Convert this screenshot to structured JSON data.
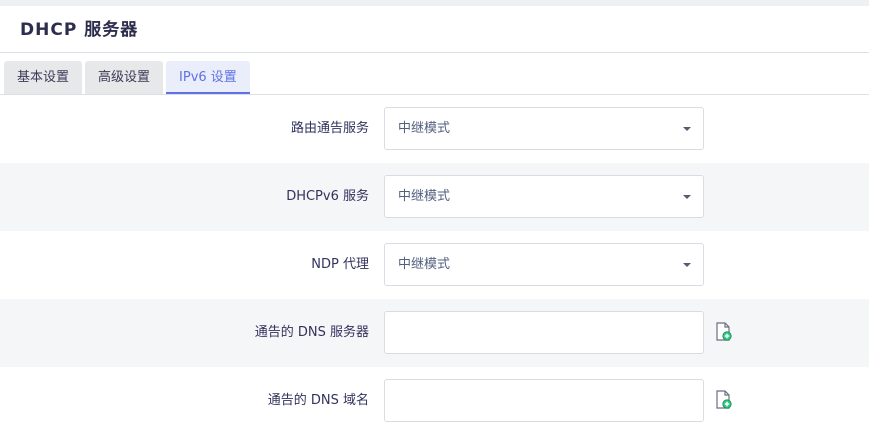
{
  "section": {
    "title": "DHCP 服务器"
  },
  "tabs": [
    {
      "label": "基本设置",
      "active": false
    },
    {
      "label": "高级设置",
      "active": false
    },
    {
      "label": "IPv6 设置",
      "active": true
    }
  ],
  "form": {
    "router_advert": {
      "label": "路由通告服务",
      "value": "中继模式"
    },
    "dhcpv6": {
      "label": "DHCPv6 服务",
      "value": "中继模式"
    },
    "ndp_proxy": {
      "label": "NDP 代理",
      "value": "中继模式"
    },
    "dns_servers": {
      "label": "通告的 DNS 服务器",
      "value": "",
      "add_icon": "add-entry-icon"
    },
    "dns_domains": {
      "label": "通告的 DNS 域名",
      "value": "",
      "add_icon": "add-entry-icon"
    }
  },
  "colors": {
    "accent": "#5e72e4",
    "add_icon_green": "#2dce89",
    "shaded_row": "#f5f6f8"
  }
}
